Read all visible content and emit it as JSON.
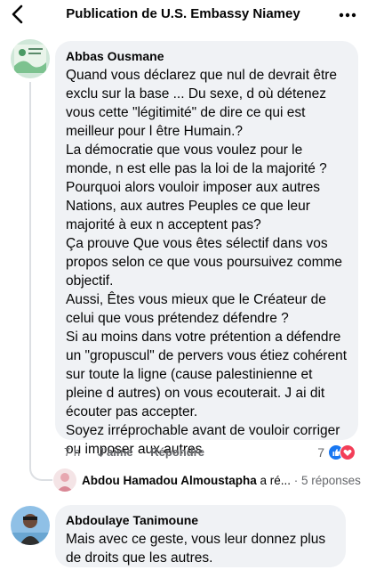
{
  "header": {
    "title": "Publication de U.S. Embassy Niamey",
    "back_icon": "chevron-left-icon",
    "more_icon": "ellipsis-icon"
  },
  "comments": [
    {
      "author": "Abbas Ousmane",
      "text": "Quand vous déclarez que nul de devrait être exclu sur la base ... Du sexe, d où détenez vous cette \"légitimité\" de dire ce qui est meilleur pour l être Humain.?\nLa démocratie que vous voulez pour le monde, n est elle pas la loi de la majorité ?\nPourquoi alors vouloir imposer aux autres Nations, aux autres Peuples ce que leur majorité à eux n acceptent pas?\nÇa prouve Que vous êtes sélectif dans vos propos selon ce que vous poursuivez comme objectif.\nAussi, Êtes vous mieux que le Créateur de celui que vous prétendez défendre ?\nSi au moins dans votre prétention a défendre un \"gropuscul\" de pervers vous étiez cohérent sur toute la ligne (cause palestinienne et pleine d autres) on vous ecouterait. J ai dit écouter pas accepter.\nSoyez irréprochable avant de vouloir corriger ou imposer aux autres",
      "time": "7 h",
      "like_label": "J'aime",
      "reply_label": "Répondre",
      "reaction_count": "7",
      "reactions": [
        "like-icon",
        "love-icon"
      ],
      "reply_summary": {
        "name": "Abdou Hamadou Almoustapha",
        "action": " a ré...",
        "separator": " · ",
        "count": "5 réponses"
      }
    },
    {
      "author": "Abdoulaye Tanimoune",
      "text": "Mais avec ce geste, vous leur donnez plus de droits que les autres."
    }
  ],
  "colors": {
    "bubble": "#f0f2f5",
    "meta": "#65676b",
    "like": "#1877f2",
    "love": "#f33e58"
  }
}
